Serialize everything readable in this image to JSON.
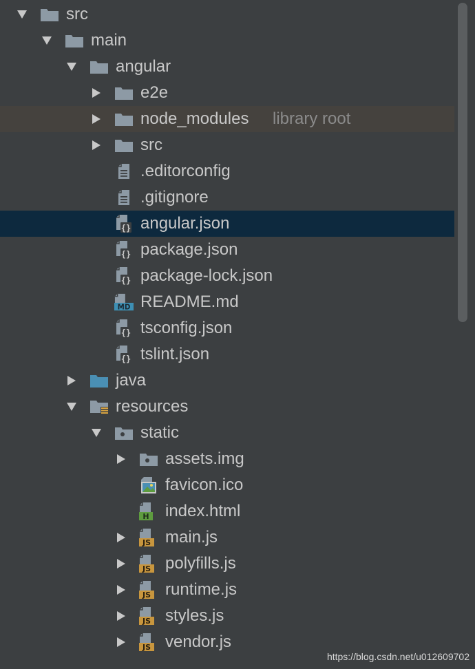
{
  "tree": [
    {
      "label": "src",
      "depth": 0,
      "arrow": "down",
      "icon": "folder"
    },
    {
      "label": "main",
      "depth": 1,
      "arrow": "down",
      "icon": "folder"
    },
    {
      "label": "angular",
      "depth": 2,
      "arrow": "down",
      "icon": "folder"
    },
    {
      "label": "e2e",
      "depth": 3,
      "arrow": "right",
      "icon": "folder"
    },
    {
      "label": "node_modules",
      "hint": "library root",
      "depth": 3,
      "arrow": "right",
      "icon": "folder",
      "highlight": "library"
    },
    {
      "label": "src",
      "depth": 3,
      "arrow": "right",
      "icon": "folder"
    },
    {
      "label": ".editorconfig",
      "depth": 3,
      "arrow": "none",
      "icon": "text-file"
    },
    {
      "label": ".gitignore",
      "depth": 3,
      "arrow": "none",
      "icon": "text-file"
    },
    {
      "label": "angular.json",
      "depth": 3,
      "arrow": "none",
      "icon": "json-file",
      "highlight": "selected"
    },
    {
      "label": "package.json",
      "depth": 3,
      "arrow": "none",
      "icon": "json-file"
    },
    {
      "label": "package-lock.json",
      "depth": 3,
      "arrow": "none",
      "icon": "json-file"
    },
    {
      "label": "README.md",
      "depth": 3,
      "arrow": "none",
      "icon": "md-file"
    },
    {
      "label": "tsconfig.json",
      "depth": 3,
      "arrow": "none",
      "icon": "json-file"
    },
    {
      "label": "tslint.json",
      "depth": 3,
      "arrow": "none",
      "icon": "json-file"
    },
    {
      "label": "java",
      "depth": 2,
      "arrow": "right",
      "icon": "source-folder"
    },
    {
      "label": "resources",
      "depth": 2,
      "arrow": "down",
      "icon": "resources-folder"
    },
    {
      "label": "static",
      "depth": 3,
      "arrow": "down",
      "icon": "package-folder"
    },
    {
      "label": "assets.img",
      "depth": 4,
      "arrow": "right",
      "icon": "package-folder"
    },
    {
      "label": "favicon.ico",
      "depth": 4,
      "arrow": "none",
      "icon": "image-file"
    },
    {
      "label": "index.html",
      "depth": 4,
      "arrow": "none",
      "icon": "html-file"
    },
    {
      "label": "main.js",
      "depth": 4,
      "arrow": "right",
      "icon": "js-file"
    },
    {
      "label": "polyfills.js",
      "depth": 4,
      "arrow": "right",
      "icon": "js-file"
    },
    {
      "label": "runtime.js",
      "depth": 4,
      "arrow": "right",
      "icon": "js-file"
    },
    {
      "label": "styles.js",
      "depth": 4,
      "arrow": "right",
      "icon": "js-file"
    },
    {
      "label": "vendor.js",
      "depth": 4,
      "arrow": "right",
      "icon": "js-file"
    }
  ],
  "icon_text": {
    "md": "MD",
    "html": "H",
    "js": "JS",
    "json": "{}"
  },
  "watermark": "https://blog.csdn.net/u012609702",
  "colors": {
    "background": "#3c3f41",
    "selected_row": "#0d293e",
    "library_row": "#45423e",
    "folder": "#8d9aa5",
    "source_folder": "#4a8fb4",
    "md_badge": "#3d8fb4",
    "html_badge": "#5e9c3f",
    "js_badge": "#c8963e",
    "text": "#c8c8c8",
    "hint": "#8b8b8b"
  }
}
